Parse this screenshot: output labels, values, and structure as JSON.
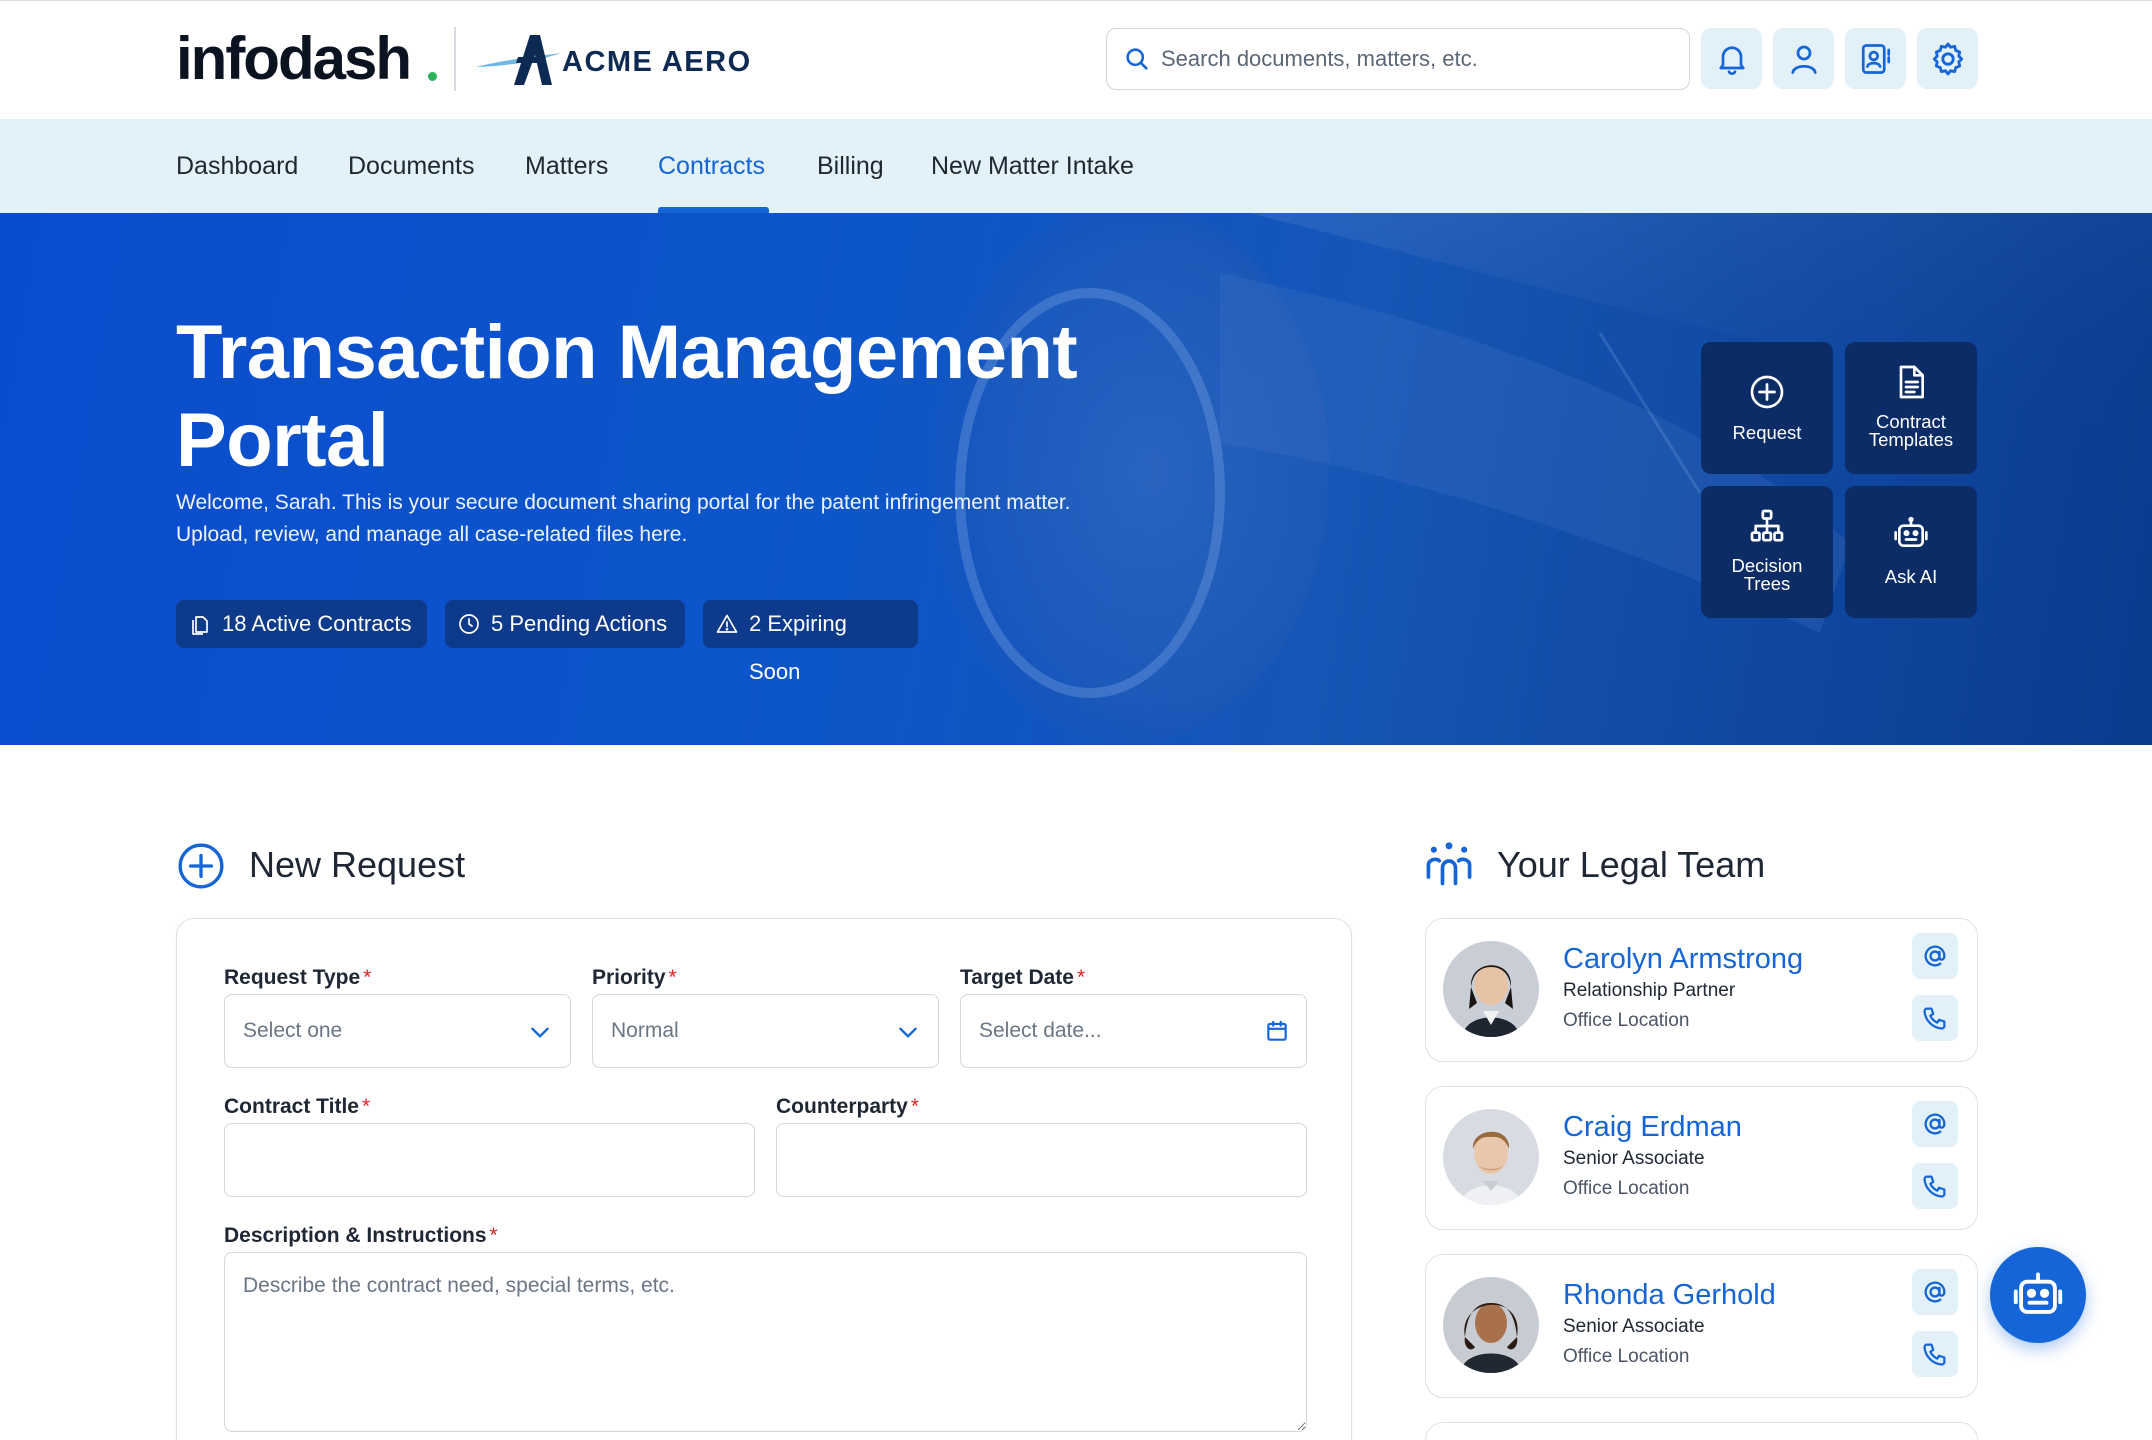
{
  "brand": {
    "logo_text": "infodash",
    "client_logo_text": "ACME AERO",
    "accent_color": "#1565d8",
    "logo_dot_color": "#2bb35a"
  },
  "header": {
    "search_placeholder": "Search documents, matters, etc.",
    "icons": [
      "bell-icon",
      "user-icon",
      "contacts-icon",
      "gear-icon"
    ]
  },
  "nav": {
    "items": [
      {
        "label": "Dashboard"
      },
      {
        "label": "Documents"
      },
      {
        "label": "Matters"
      },
      {
        "label": "Contracts",
        "active": true
      },
      {
        "label": "Billing"
      },
      {
        "label": "New Matter Intake"
      }
    ]
  },
  "hero": {
    "title": "Transaction Management Portal",
    "subtitle": "Welcome, Sarah. This is your secure document sharing portal for the patent infringement matter. Upload, review, and manage all case-related files here.",
    "stats": [
      {
        "icon": "documents-icon",
        "label": "18 Active Contracts"
      },
      {
        "icon": "clock-icon",
        "label": "5 Pending Actions"
      },
      {
        "icon": "warning-icon",
        "label": "2 Expiring Soon"
      }
    ],
    "quick_actions": [
      {
        "icon": "plus-circle-icon",
        "label": "Request"
      },
      {
        "icon": "document-icon",
        "label_line1": "Contract",
        "label_line2": "Templates"
      },
      {
        "icon": "hierarchy-icon",
        "label_line1": "Decision",
        "label_line2": "Trees"
      },
      {
        "icon": "robot-icon",
        "label": "Ask AI"
      }
    ]
  },
  "new_request": {
    "title": "New Request",
    "request_type": {
      "label": "Request Type",
      "value": "Select one"
    },
    "priority": {
      "label": "Priority",
      "value": "Normal"
    },
    "target_date": {
      "label": "Target Date",
      "placeholder": "Select date..."
    },
    "contract_title": {
      "label": "Contract Title",
      "value": ""
    },
    "counterparty": {
      "label": "Counterparty",
      "value": ""
    },
    "description": {
      "label": "Description & Instructions",
      "placeholder": "Describe the contract need, special terms, etc."
    },
    "required_marker": "*"
  },
  "legal_team": {
    "title": "Your Legal Team",
    "members": [
      {
        "name": "Carolyn Armstrong",
        "role": "Relationship Partner",
        "location": "Office Location"
      },
      {
        "name": "Craig Erdman",
        "role": "Senior Associate",
        "location": "Office Location"
      },
      {
        "name": "Rhonda Gerhold",
        "role": "Senior Associate",
        "location": "Office Location"
      }
    ]
  }
}
